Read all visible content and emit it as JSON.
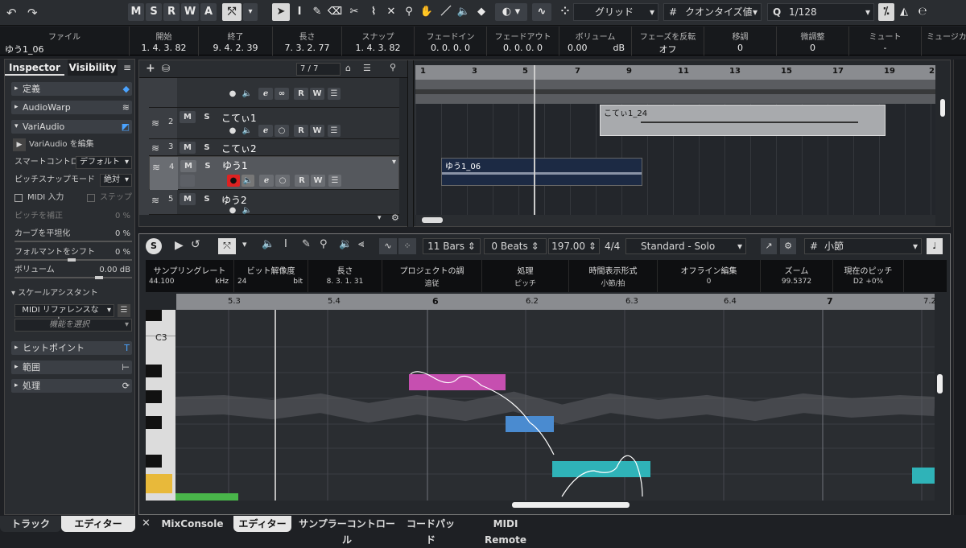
{
  "toolbar": {
    "msrwa": [
      "M",
      "S",
      "R",
      "W",
      "A"
    ],
    "grid_type": "グリッド",
    "quantize_type": "クオンタイズ値",
    "quantize_value": "1/128"
  },
  "info_line": {
    "columns": [
      {
        "label": "ファイル",
        "value": "ゆう1_06"
      },
      {
        "label": "開始",
        "value": "1. 4. 3. 82"
      },
      {
        "label": "終了",
        "value": "9. 4. 2. 39"
      },
      {
        "label": "長さ",
        "value": "7. 3. 2. 77"
      },
      {
        "label": "スナップ",
        "value": "1. 4. 3. 82"
      },
      {
        "label": "フェードイン",
        "value": "0. 0. 0. 0"
      },
      {
        "label": "フェードアウト",
        "value": "0. 0. 0. 0"
      },
      {
        "label": "ボリューム",
        "value": "0.00",
        "unit": "dB"
      },
      {
        "label": "フェーズを反転",
        "value": "オフ"
      },
      {
        "label": "移調",
        "value": "0"
      },
      {
        "label": "微調整",
        "value": "0"
      },
      {
        "label": "ミュート",
        "value": "-"
      },
      {
        "label": "ミュージカル",
        "value": ""
      }
    ]
  },
  "inspector": {
    "tabs": [
      "Inspector",
      "Visibility"
    ],
    "sections": {
      "def": "定義",
      "audiowarp": "AudioWarp",
      "variaudio": "VariAudio",
      "hitpoints": "ヒットポイント",
      "range": "範囲",
      "process": "処理"
    },
    "edit_label": "VariAudio を編集",
    "smart_control": {
      "label": "スマートコントロール",
      "value": "デフォルト"
    },
    "pitch_snap": {
      "label": "ピッチスナップモード",
      "value": "絶対"
    },
    "midi_input": "MIDI 入力",
    "step": "ステップ",
    "pitch_correct": {
      "label": "ピッチを補正",
      "value": "0 %"
    },
    "curve_flatten": {
      "label": "カーブを平坦化",
      "value": "0 %"
    },
    "formant_shift": {
      "label": "フォルマントをシフト",
      "value": "0 %"
    },
    "volume": {
      "label": "ボリューム",
      "value": "0.00 dB"
    },
    "scale_assistant": "スケールアシスタント",
    "midi_ref": "MIDI リファレンスなし",
    "func_select": "機能を選択"
  },
  "project": {
    "track_count": "7 / 7",
    "tracks": [
      {
        "num": "",
        "name": ""
      },
      {
        "num": "2",
        "name": "こてぃ1"
      },
      {
        "num": "3",
        "name": "こてぃ2"
      },
      {
        "num": "4",
        "name": "ゆう1"
      },
      {
        "num": "5",
        "name": "ゆう2"
      }
    ],
    "ruler": [
      "1",
      "3",
      "5",
      "7",
      "9",
      "11",
      "13",
      "15",
      "17",
      "19",
      "2"
    ],
    "parts": [
      {
        "name": "こてぃ1_24"
      },
      {
        "name": "ゆう1_06"
      }
    ]
  },
  "editor": {
    "length_bars": "11 Bars",
    "beats": "0 Beats",
    "tempo": "197.00",
    "signature": "4/4",
    "mode": "Standard - Solo",
    "grid": "小節",
    "header": [
      {
        "label": "サンプリングレート",
        "value": "44.100",
        "unit": "kHz"
      },
      {
        "label": "ビット解像度",
        "value": "24",
        "unit": "bit"
      },
      {
        "label": "長さ",
        "value": "8. 3. 1. 31"
      },
      {
        "label": "プロジェクトの調",
        "value": "追従"
      },
      {
        "label": "処理",
        "value": "ピッチ"
      },
      {
        "label": "時間表示形式",
        "value": "小節/拍"
      },
      {
        "label": "オフライン編集",
        "value": "0"
      },
      {
        "label": "ズーム",
        "value": "99.5372"
      },
      {
        "label": "現在のピッチ",
        "value": "D2 +0%"
      }
    ],
    "ruler": [
      "5.3",
      "5.4",
      "6",
      "6.2",
      "6.3",
      "6.4",
      "7",
      "7.2"
    ],
    "key_label": "C3",
    "colors": {
      "pink": "#c64fb0",
      "blue": "#4a8bd0",
      "teal": "#2fb3b8",
      "green": "#49b54a",
      "yellow": "#e8b93a"
    }
  },
  "bottom_tabs": {
    "track": "トラック",
    "editor_left": "エディター",
    "mixconsole": "MixConsole",
    "editor": "エディター",
    "sampler": "サンプラーコントロール",
    "chordpad": "コードパッド",
    "midiremote": "MIDI Remote"
  }
}
